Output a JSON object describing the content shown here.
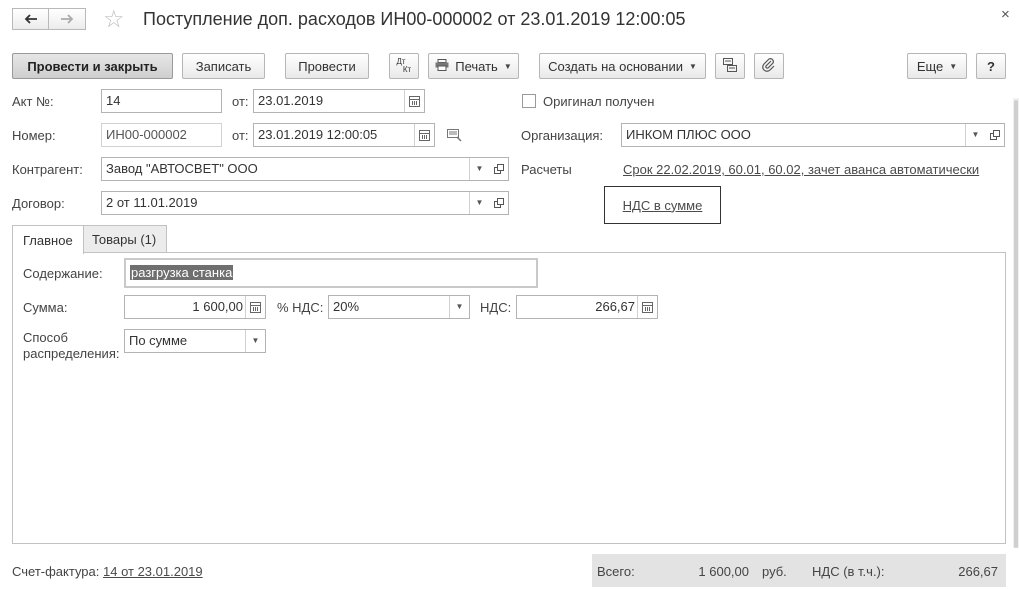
{
  "window": {
    "title": "Поступление доп. расходов ИН00-000002 от 23.01.2019 12:00:05",
    "close_glyph": "×",
    "star_glyph": "☆"
  },
  "toolbar": {
    "post_close": "Провести и закрыть",
    "save": "Записать",
    "post": "Провести",
    "dtkt_top": "Дт",
    "dtkt_bottom": "Кт",
    "print": "Печать",
    "create_based": "Создать на основании",
    "more": "Еще",
    "help": "?"
  },
  "header": {
    "act_label": "Акт №:",
    "act_number": "14",
    "from_label": "от:",
    "act_date": "23.01.2019",
    "original_label": "Оригинал получен",
    "original_checked": false,
    "number_label": "Номер:",
    "number_value": "ИН00-000002",
    "number_date": "23.01.2019 12:00:05",
    "org_label": "Организация:",
    "org_value": "ИНКОМ ПЛЮС ООО",
    "contractor_label": "Контрагент:",
    "contractor_value": "Завод \"АВТОСВЕТ\" ООО",
    "settlements_label": "Расчеты",
    "settlements_link": "Срок 22.02.2019, 60.01, 60.02, зачет аванса автоматически",
    "contract_label": "Договор:",
    "contract_value": "2 от 11.01.2019",
    "vat_mode_link": "НДС в сумме"
  },
  "tabs": [
    {
      "label": "Главное",
      "active": true
    },
    {
      "label": "Товары (1)",
      "active": false
    }
  ],
  "main": {
    "content_label": "Содержание:",
    "content_value": "разгрузка станка",
    "sum_label": "Сумма:",
    "sum_value": "1 600,00",
    "vat_rate_label": "% НДС:",
    "vat_rate_value": "20%",
    "vat_label": "НДС:",
    "vat_value": "266,67",
    "distribution_label_1": "Способ",
    "distribution_label_2": "распределения:",
    "distribution_value": "По сумме"
  },
  "footer": {
    "invoice_label": "Счет-фактура:",
    "invoice_link": "14 от 23.01.2019",
    "total_label": "Всего:",
    "total_value": "1 600,00",
    "currency": "руб.",
    "vat_incl_label": "НДС (в т.ч.):",
    "vat_incl_value": "266,67"
  },
  "colors": {
    "primary_button": "#d6d6d6",
    "link": "#4a4a4a",
    "selection": "#6f6f6f",
    "total_bg": "#e3e3e3"
  }
}
